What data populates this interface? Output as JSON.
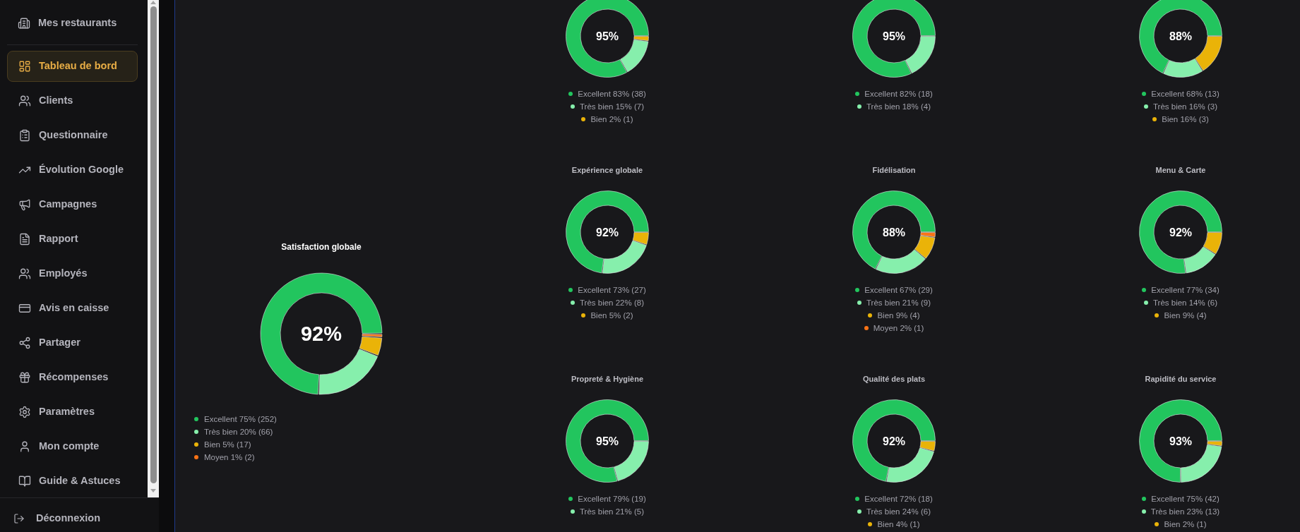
{
  "sidebar": {
    "header": {
      "label": "Mes restaurants"
    },
    "items": [
      {
        "label": "Tableau de bord",
        "selected": true
      },
      {
        "label": "Clients",
        "selected": false
      },
      {
        "label": "Questionnaire",
        "selected": false
      },
      {
        "label": "Évolution Google",
        "selected": false
      },
      {
        "label": "Campagnes",
        "selected": false
      },
      {
        "label": "Rapport",
        "selected": false
      },
      {
        "label": "Employés",
        "selected": false
      },
      {
        "label": "Avis en caisse",
        "selected": false
      },
      {
        "label": "Partager",
        "selected": false
      },
      {
        "label": "Récompenses",
        "selected": false
      },
      {
        "label": "Paramètres",
        "selected": false
      },
      {
        "label": "Mon compte",
        "selected": false
      },
      {
        "label": "Guide & Astuces",
        "selected": false
      }
    ],
    "footer": {
      "label": "Déconnexion"
    }
  },
  "overall": {
    "title": "Satisfaction globale",
    "center_value": "92%",
    "chart_data": {
      "type": "donut",
      "values": [
        75,
        20,
        5,
        1
      ]
    },
    "legend": [
      {
        "label": "Excellent 75% (252)",
        "color": "#22c55e"
      },
      {
        "label": "Très bien 20% (66)",
        "color": "#86efac"
      },
      {
        "label": "Bien 5% (17)",
        "color": "#eab308"
      },
      {
        "label": "Moyen 1% (2)",
        "color": "#f97316"
      }
    ]
  },
  "categories": [
    {
      "center_value": "95%",
      "chart_data": {
        "type": "donut",
        "values": [
          83,
          15,
          2
        ]
      },
      "legend": [
        {
          "label": "Excellent 83% (38)",
          "color": "#22c55e"
        },
        {
          "label": "Très bien 15% (7)",
          "color": "#86efac"
        },
        {
          "label": "Bien 2% (1)",
          "color": "#eab308"
        }
      ]
    },
    {
      "center_value": "95%",
      "chart_data": {
        "type": "donut",
        "values": [
          82,
          18
        ]
      },
      "legend": [
        {
          "label": "Excellent 82% (18)",
          "color": "#22c55e"
        },
        {
          "label": "Très bien 18% (4)",
          "color": "#86efac"
        }
      ]
    },
    {
      "center_value": "88%",
      "chart_data": {
        "type": "donut",
        "values": [
          68,
          16,
          16
        ]
      },
      "legend": [
        {
          "label": "Excellent 68% (13)",
          "color": "#22c55e"
        },
        {
          "label": "Très bien 16% (3)",
          "color": "#86efac"
        },
        {
          "label": "Bien 16% (3)",
          "color": "#eab308"
        }
      ]
    },
    {
      "title": "Expérience globale",
      "center_value": "92%",
      "chart_data": {
        "type": "donut",
        "values": [
          73,
          22,
          5
        ]
      },
      "legend": [
        {
          "label": "Excellent 73% (27)",
          "color": "#22c55e"
        },
        {
          "label": "Très bien 22% (8)",
          "color": "#86efac"
        },
        {
          "label": "Bien 5% (2)",
          "color": "#eab308"
        }
      ]
    },
    {
      "title": "Fidélisation",
      "center_value": "88%",
      "chart_data": {
        "type": "donut",
        "values": [
          67,
          21,
          9,
          2
        ]
      },
      "legend": [
        {
          "label": "Excellent 67% (29)",
          "color": "#22c55e"
        },
        {
          "label": "Très bien 21% (9)",
          "color": "#86efac"
        },
        {
          "label": "Bien 9% (4)",
          "color": "#eab308"
        },
        {
          "label": "Moyen 2% (1)",
          "color": "#f97316"
        }
      ]
    },
    {
      "title": "Menu & Carte",
      "center_value": "92%",
      "chart_data": {
        "type": "donut",
        "values": [
          77,
          14,
          9
        ]
      },
      "legend": [
        {
          "label": "Excellent 77% (34)",
          "color": "#22c55e"
        },
        {
          "label": "Très bien 14% (6)",
          "color": "#86efac"
        },
        {
          "label": "Bien 9% (4)",
          "color": "#eab308"
        }
      ]
    },
    {
      "title": "Propreté & Hygiène",
      "center_value": "95%",
      "chart_data": {
        "type": "donut",
        "values": [
          79,
          21
        ]
      },
      "legend": [
        {
          "label": "Excellent 79% (19)",
          "color": "#22c55e"
        },
        {
          "label": "Très bien 21% (5)",
          "color": "#86efac"
        }
      ]
    },
    {
      "title": "Qualité des plats",
      "center_value": "92%",
      "chart_data": {
        "type": "donut",
        "values": [
          72,
          24,
          4
        ]
      },
      "legend": [
        {
          "label": "Excellent 72% (18)",
          "color": "#22c55e"
        },
        {
          "label": "Très bien 24% (6)",
          "color": "#86efac"
        },
        {
          "label": "Bien 4% (1)",
          "color": "#eab308"
        }
      ]
    },
    {
      "title": "Rapidité du service",
      "center_value": "93%",
      "chart_data": {
        "type": "donut",
        "values": [
          75,
          23,
          2
        ]
      },
      "legend": [
        {
          "label": "Excellent 75% (42)",
          "color": "#22c55e"
        },
        {
          "label": "Très bien 23% (13)",
          "color": "#86efac"
        },
        {
          "label": "Bien 2% (1)",
          "color": "#eab308"
        }
      ]
    }
  ]
}
